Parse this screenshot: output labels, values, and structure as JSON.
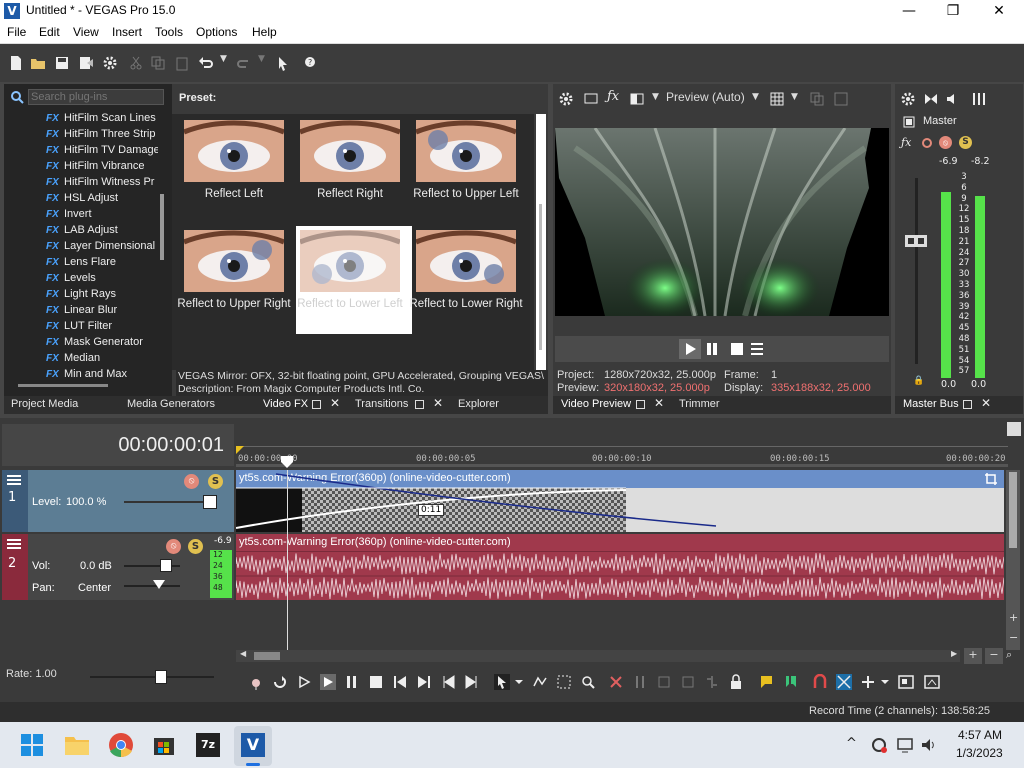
{
  "window": {
    "title": "Untitled * - VEGAS Pro 15.0",
    "app_icon": "V"
  },
  "menu": [
    "File",
    "Edit",
    "View",
    "Insert",
    "Tools",
    "Options",
    "Help"
  ],
  "plugins": {
    "search_placeholder": "Search plug-ins",
    "items": [
      "HitFilm Scan Lines",
      "HitFilm Three Strip",
      "HitFilm TV Damage",
      "HitFilm Vibrance",
      "HitFilm Witness Pr",
      "HSL Adjust",
      "Invert",
      "LAB Adjust",
      "Layer Dimensional",
      "Lens Flare",
      "Levels",
      "Light Rays",
      "Linear Blur",
      "LUT Filter",
      "Mask Generator",
      "Median",
      "Min and Max"
    ],
    "fx_badge": "FX"
  },
  "preset": {
    "header": "Preset:",
    "items": [
      "Reflect Left",
      "Reflect Right",
      "Reflect to Upper Left",
      "Reflect to Upper Right",
      "Reflect to Lower Left",
      "Reflect to Lower Right"
    ],
    "selected_index": 4,
    "info_line1": "VEGAS Mirror: OFX, 32-bit floating point, GPU Accelerated, Grouping VEGAS\\",
    "info_line2": "Description: From Magix Computer Products Intl. Co."
  },
  "left_tabs": {
    "project_media": "Project Media",
    "media_generators": "Media Generators",
    "video_fx": "Video FX",
    "transitions": "Transitions",
    "explorer": "Explorer"
  },
  "preview": {
    "mode": "Preview (Auto)",
    "project_label": "Project:",
    "project_value": "1280x720x32, 25.000p",
    "preview_label": "Preview:",
    "preview_value": "320x180x32, 25.000p",
    "frame_label": "Frame:",
    "frame_value": "1",
    "display_label": "Display:",
    "display_value": "335x188x32, 25.000",
    "tab_video_preview": "Video Preview",
    "tab_trimmer": "Trimmer"
  },
  "master": {
    "label": "Master",
    "peak_left": "-6.9",
    "peak_right": "-8.2",
    "scale": [
      "3",
      "6",
      "9",
      "12",
      "15",
      "18",
      "21",
      "24",
      "27",
      "30",
      "33",
      "36",
      "39",
      "42",
      "45",
      "48",
      "51",
      "54",
      "57"
    ],
    "bottom_left": "0.0",
    "bottom_right": "0.0",
    "tab": "Master Bus"
  },
  "timeline": {
    "timecode": "00:00:00:01",
    "ruler": [
      "00:00:00:00",
      "00:00:00:05",
      "00:00:00:10",
      "00:00:00:15",
      "00:00:00:20"
    ],
    "video_track": {
      "number": "1",
      "level_label": "Level:",
      "level_value": "100.0 %",
      "clip_name": "yt5s.com-Warning Error(360p) (online-video-cutter.com)",
      "fade_label": "0:11"
    },
    "audio_track": {
      "number": "2",
      "vol_label": "Vol:",
      "vol_value": "0.0 dB",
      "pan_label": "Pan:",
      "pan_value": "Center",
      "peak": "-6.9",
      "meter": [
        "12",
        "24",
        "36",
        "48"
      ],
      "clip_name": "yt5s.com-Warning Error(360p) (online-video-cutter.com)"
    },
    "rate": "Rate: 1.00"
  },
  "status": {
    "record_time": "Record Time (2 channels): 138:58:25"
  },
  "taskbar": {
    "time": "4:57 AM",
    "date": "1/3/2023",
    "vegas_icon": "V"
  },
  "colors": {
    "accent_blue": "#4aa3ff",
    "video_clip": "#6a8fc9",
    "audio_clip": "#a0394c",
    "meter_green": "#56e24a",
    "preview_red": "#f07070"
  }
}
